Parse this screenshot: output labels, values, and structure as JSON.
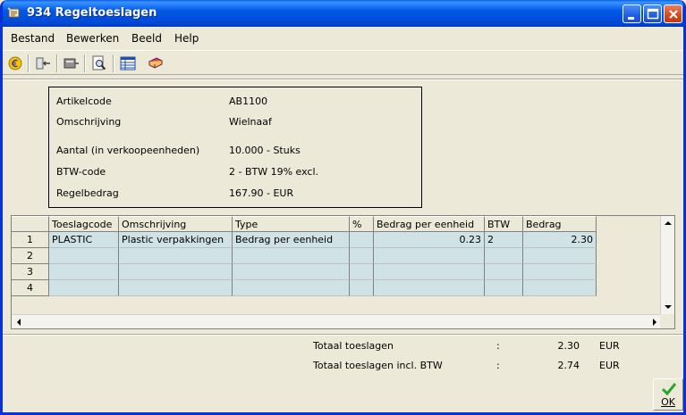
{
  "window": {
    "title": "934 Regeltoeslagen"
  },
  "menu": {
    "items": [
      {
        "label": "Bestand"
      },
      {
        "label": "Bewerken"
      },
      {
        "label": "Beeld"
      },
      {
        "label": "Help"
      }
    ]
  },
  "toolbar": {
    "icons": [
      "euro-icon",
      "record-back-icon",
      "record-forward-icon",
      "print-preview-icon",
      "table-view-icon",
      "book-icon"
    ]
  },
  "article": {
    "code_label": "Artikelcode",
    "code_value": "AB1100",
    "desc_label": "Omschrijving",
    "desc_value": "Wielnaaf",
    "qty_label": "Aantal (in verkoopeenheden)",
    "qty_value": "10.000 - Stuks",
    "vat_label": "BTW-code",
    "vat_value": "2 - BTW 19% excl.",
    "amount_label": "Regelbedrag",
    "amount_value": "167.90 - EUR"
  },
  "table": {
    "headers": [
      "Toeslagcode",
      "Omschrijving",
      "Type",
      "%",
      "Bedrag per eenheid",
      "BTW",
      "Bedrag"
    ],
    "rows": [
      {
        "num": "1",
        "cells": [
          "PLASTIC",
          "Plastic verpakkingen",
          "Bedrag per eenheid",
          "",
          "0.23",
          "2",
          "2.30"
        ]
      },
      {
        "num": "2",
        "cells": [
          "",
          "",
          "",
          "",
          "",
          "",
          ""
        ]
      },
      {
        "num": "3",
        "cells": [
          "",
          "",
          "",
          "",
          "",
          "",
          ""
        ]
      },
      {
        "num": "4",
        "cells": [
          "",
          "",
          "",
          "",
          "",
          "",
          ""
        ]
      }
    ]
  },
  "totals": {
    "total_label": "Totaal toeslagen",
    "total_colon": ":",
    "total_value": "2.30",
    "total_currency": "EUR",
    "total_vat_label": "Totaal toeslagen incl. BTW",
    "total_vat_colon": ":",
    "total_vat_value": "2.74",
    "total_vat_currency": "EUR"
  },
  "ok_button": {
    "label": "OK"
  },
  "colors": {
    "title_bar": "#0058e6",
    "grid_cell": "#cfe2e6",
    "face": "#ece9d8"
  }
}
